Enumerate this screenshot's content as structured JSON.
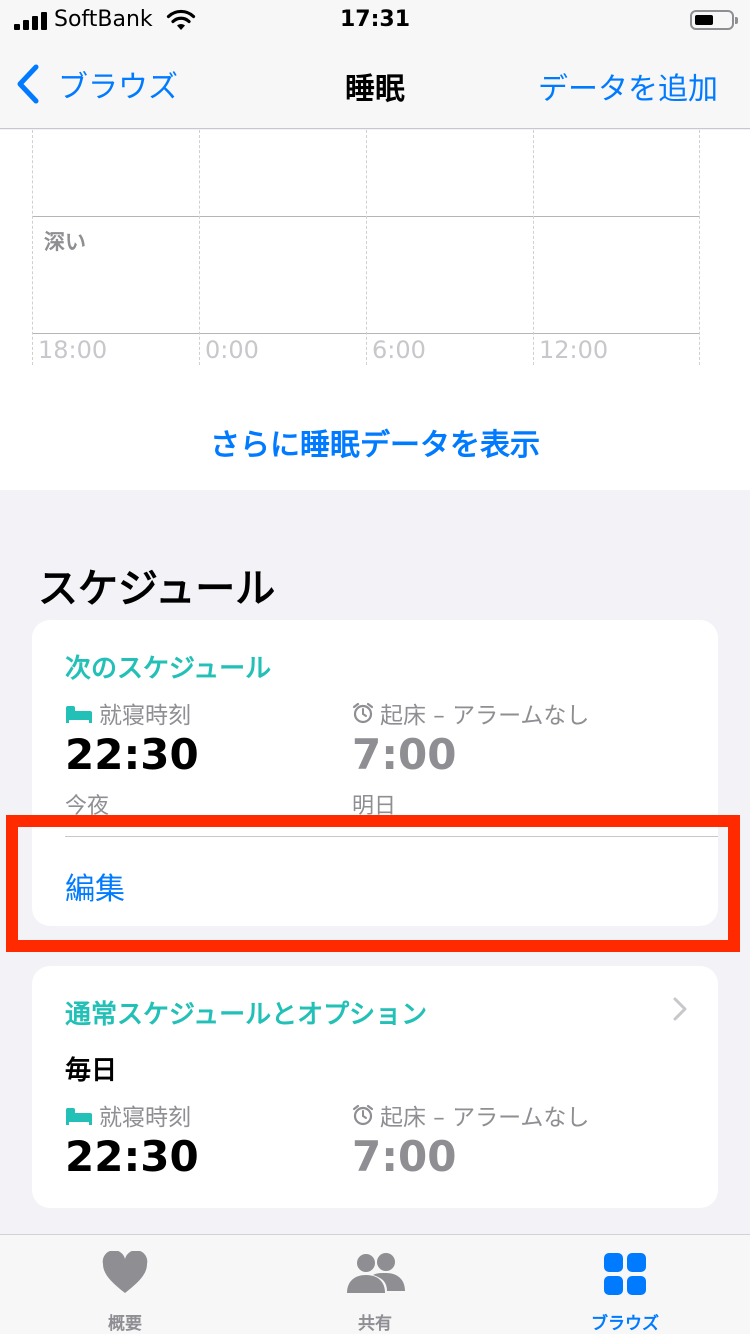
{
  "status_bar": {
    "carrier": "SoftBank",
    "time": "17:31"
  },
  "nav": {
    "back_label": "ブラウズ",
    "title": "睡眠",
    "add_label": "データを追加"
  },
  "chart_data": {
    "type": "bar",
    "categories": [
      "深い"
    ],
    "x_ticks": [
      "18:00",
      "0:00",
      "6:00",
      "12:00"
    ],
    "series": []
  },
  "more_link": "さらに睡眠データを表示",
  "schedule": {
    "title": "スケジュール",
    "next": {
      "heading": "次のスケジュール",
      "bedtime_label": "就寝時刻",
      "bedtime": "22:30",
      "bedtime_day": "今夜",
      "wake_label": "起床 – アラームなし",
      "wake": "7:00",
      "wake_day": "明日",
      "edit_label": "編集"
    },
    "regular": {
      "heading": "通常スケジュールとオプション",
      "frequency": "毎日",
      "bedtime_label": "就寝時刻",
      "bedtime": "22:30",
      "wake_label": "起床 – アラームなし",
      "wake": "7:00"
    }
  },
  "tabs": [
    {
      "label": "概要",
      "icon": "heart-icon"
    },
    {
      "label": "共有",
      "icon": "people-icon"
    },
    {
      "label": "ブラウズ",
      "icon": "grid-icon",
      "active": true
    }
  ],
  "colors": {
    "accent": "#007aff",
    "teal": "#22c0b6",
    "highlight": "#ff2a00"
  }
}
